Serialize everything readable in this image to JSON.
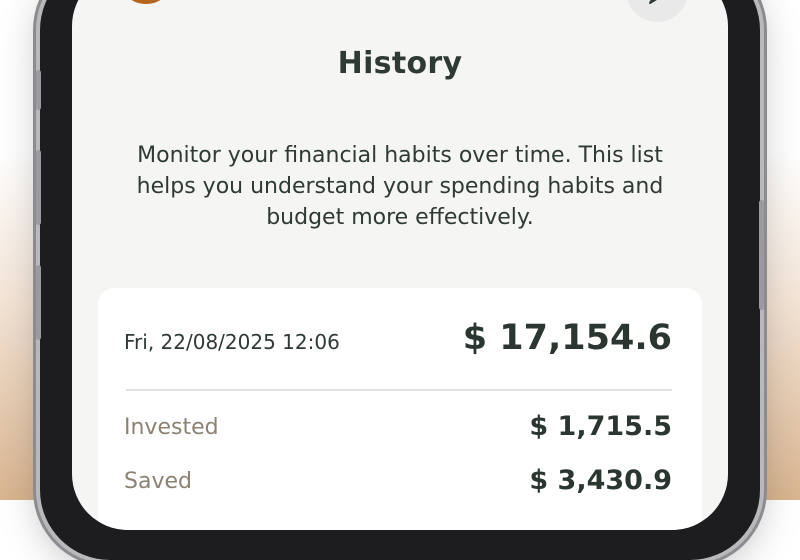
{
  "page": {
    "title": "History",
    "description": "Monitor your financial habits over time. This list helps you understand your spending habits and budget more effectively."
  },
  "header": {
    "logo_icon": "leaf-logo-icon",
    "action_icon": "share-icon"
  },
  "entry": {
    "date": "Fri, 22/08/2025 12:06",
    "total": "$ 17,154.6",
    "rows": [
      {
        "label": "Invested",
        "value": "$ 1,715.5"
      },
      {
        "label": "Saved",
        "value": "$ 3,430.9"
      }
    ]
  },
  "colors": {
    "brand": "#b5651d",
    "text_dark": "#2f3a34",
    "muted_label": "#8c8274",
    "screen_bg": "#f5f5f4"
  }
}
